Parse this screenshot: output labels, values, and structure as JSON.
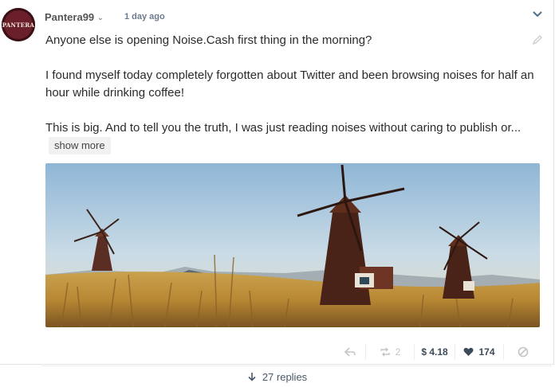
{
  "post": {
    "author": "Pantera99",
    "avatar_text": "PANTERA",
    "time": "1 day ago",
    "paragraphs": [
      "Anyone else is opening Noise.Cash first thing in the morning?",
      "I found myself today completely forgotten about Twitter and been browsing noises for half an hour while drinking coffee!",
      "This is big. And to tell you the truth, I was just reading noises without caring to publish or..."
    ],
    "show_more_label": "show more"
  },
  "actions": {
    "repost_count": "2",
    "tip_amount": "$ 4.18",
    "like_count": "174"
  },
  "replies": {
    "label": "27 replies"
  },
  "colors": {
    "accent_dark": "#3d4a59",
    "muted": "#c4c4c4",
    "heart": "#3d4a59"
  },
  "icons": [
    "chevron-down-icon",
    "pencil-icon",
    "reply-icon",
    "repost-icon",
    "heart-icon",
    "block-icon",
    "arrow-down-icon"
  ]
}
